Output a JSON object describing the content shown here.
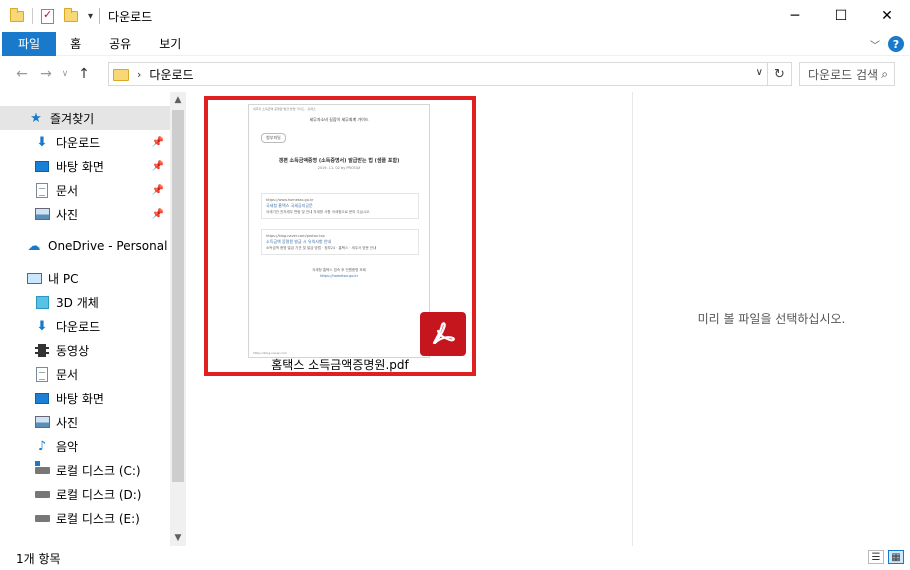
{
  "window": {
    "title": "다운로드"
  },
  "ribbon": {
    "tabs": [
      "파일",
      "홈",
      "공유",
      "보기"
    ]
  },
  "address": {
    "crumb": "다운로드",
    "search_placeholder": "다운로드 검색"
  },
  "nav": {
    "items": [
      {
        "label": "즐겨찾기",
        "icon": "star-icon"
      },
      {
        "label": "다운로드",
        "icon": "download-arrow-icon"
      },
      {
        "label": "바탕 화면",
        "icon": "desktop-icon"
      },
      {
        "label": "문서",
        "icon": "document-icon"
      },
      {
        "label": "사진",
        "icon": "picture-icon"
      },
      {
        "label": "OneDrive - Personal",
        "icon": "cloud-icon"
      },
      {
        "label": "내 PC",
        "icon": "pc-icon"
      },
      {
        "label": "3D 개체",
        "icon": "cube-3d-icon"
      },
      {
        "label": "다운로드",
        "icon": "download-arrow-icon"
      },
      {
        "label": "동영상",
        "icon": "video-icon"
      },
      {
        "label": "문서",
        "icon": "document-icon"
      },
      {
        "label": "바탕 화면",
        "icon": "desktop-icon"
      },
      {
        "label": "사진",
        "icon": "picture-icon"
      },
      {
        "label": "음악",
        "icon": "music-note-icon"
      },
      {
        "label": "로컬 디스크 (C:)",
        "icon": "drive-c-icon"
      },
      {
        "label": "로컬 디스크 (D:)",
        "icon": "drive-icon"
      },
      {
        "label": "로컬 디스크 (E:)",
        "icon": "drive-icon"
      }
    ]
  },
  "file": {
    "name": "홈택스 소득금액증명원.pdf",
    "thumb": {
      "header": "세무자 소득금액 증명원 발급 방법 가이드 · 홈택스",
      "site": "세무자소비 길잡이 세무회계 가이드",
      "tag": "첨부파일",
      "title": "갱편 소득금액증명 (소득증명서) 발급받는 법 (샘플 포함)",
      "sub": "2019. 11. 02 by PROTAX",
      "box1_url": "https://www.hometax.go.kr",
      "box1_title": "국세청 홈택스 국세공지공문",
      "box1_text": "국세기관 전자세무 편람 및 안내 자세한 사항 국세청으로 문의 주십시오.",
      "box2_url": "https://blog.naver.com/protax-tax",
      "box2_title": "소득금액 증명원 발급 시 유의사항 안내",
      "box2_text": "소득금액 증명 발급 기관 및 발급 방법 · 정부24 · 홈택스 · 세무서 방문 안내",
      "foot": "국세청 홈택스 접속 후 민원증명 조회",
      "foot_link": "https://hometax.go.kr",
      "bottom": "https://blog.naver.com"
    }
  },
  "preview": {
    "message": "미리 볼 파일을 선택하십시오."
  },
  "status": {
    "count": "1개 항목"
  },
  "colors": {
    "accent": "#1979ca",
    "highlight_border": "#e02020",
    "pdf_red": "#c4161c"
  }
}
